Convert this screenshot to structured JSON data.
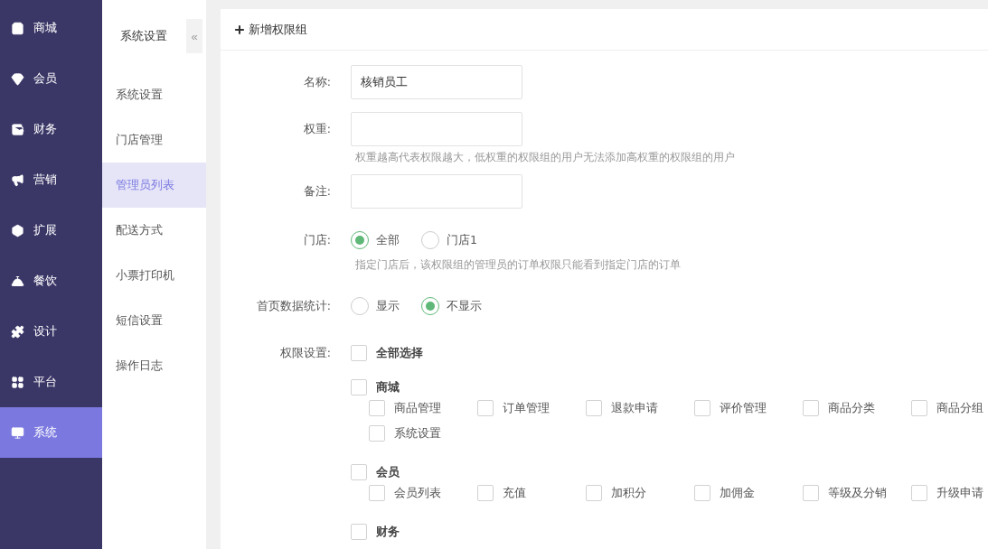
{
  "nav": [
    {
      "label": "商城",
      "selected": false
    },
    {
      "label": "会员",
      "selected": false
    },
    {
      "label": "财务",
      "selected": false
    },
    {
      "label": "营销",
      "selected": false
    },
    {
      "label": "扩展",
      "selected": false
    },
    {
      "label": "餐饮",
      "selected": false
    },
    {
      "label": "设计",
      "selected": false
    },
    {
      "label": "平台",
      "selected": false
    },
    {
      "label": "系统",
      "selected": true
    }
  ],
  "subnav": {
    "title": "系统设置",
    "collapse": "«",
    "items": [
      {
        "label": "系统设置",
        "selected": false
      },
      {
        "label": "门店管理",
        "selected": false
      },
      {
        "label": "管理员列表",
        "selected": true
      },
      {
        "label": "配送方式",
        "selected": false
      },
      {
        "label": "小票打印机",
        "selected": false
      },
      {
        "label": "短信设置",
        "selected": false
      },
      {
        "label": "操作日志",
        "selected": false
      }
    ]
  },
  "header": {
    "title": "新增权限组"
  },
  "form": {
    "name": {
      "label": "名称:",
      "value": "核销员工"
    },
    "weight": {
      "label": "权重:",
      "hint": "权重越高代表权限越大，低权重的权限组的用户无法添加高权重的权限组的用户"
    },
    "remark": {
      "label": "备注:"
    },
    "store": {
      "label": "门店:",
      "options": [
        {
          "label": "全部",
          "selected": true
        },
        {
          "label": "门店1",
          "selected": false
        }
      ],
      "hint": "指定门店后，该权限组的管理员的订单权限只能看到指定门店的订单"
    },
    "home_stats": {
      "label": "首页数据统计:",
      "options": [
        {
          "label": "显示",
          "selected": false
        },
        {
          "label": "不显示",
          "selected": true
        }
      ]
    },
    "permissions": {
      "label": "权限设置:",
      "select_all": {
        "label": "全部选择",
        "checked": false
      },
      "groups": [
        {
          "label": "商城",
          "checked": false,
          "children": [
            {
              "label": "商品管理",
              "checked": false
            },
            {
              "label": "订单管理",
              "checked": false
            },
            {
              "label": "退款申请",
              "checked": false
            },
            {
              "label": "评价管理",
              "checked": false
            },
            {
              "label": "商品分类",
              "checked": false
            },
            {
              "label": "商品分组",
              "checked": false
            },
            {
              "label": "系统设置",
              "checked": false
            }
          ]
        },
        {
          "label": "会员",
          "checked": false,
          "children": [
            {
              "label": "会员列表",
              "checked": false
            },
            {
              "label": "充值",
              "checked": false
            },
            {
              "label": "加积分",
              "checked": false
            },
            {
              "label": "加佣金",
              "checked": false
            },
            {
              "label": "等级及分销",
              "checked": false
            },
            {
              "label": "升级申请",
              "checked": false
            }
          ]
        },
        {
          "label": "财务",
          "checked": false
        }
      ]
    }
  }
}
